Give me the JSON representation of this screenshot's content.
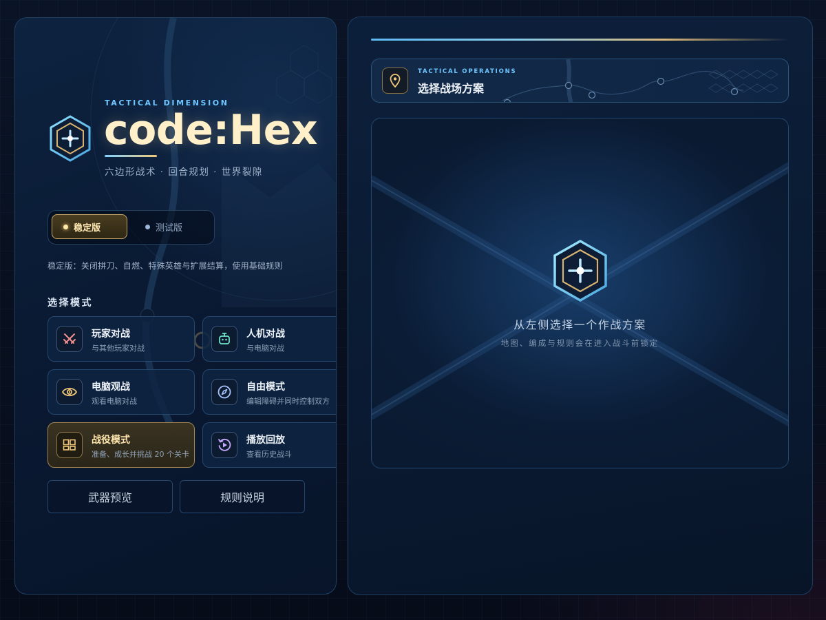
{
  "brand": {
    "kicker": "TACTICAL DIMENSION",
    "title": "code:Hex",
    "subtitle": "六边形战术 · 回合规划 · 世界裂隙",
    "logo_icon": "hex-crosshair-icon"
  },
  "version": {
    "options": [
      {
        "label": "稳定版",
        "selected": true
      },
      {
        "label": "测试版",
        "selected": false
      }
    ],
    "description": "稳定版：关闭拼刀、自燃、特殊英雄与扩展结算，使用基础规则"
  },
  "modes": {
    "heading": "选择模式",
    "items": [
      {
        "title": "玩家对战",
        "desc": "与其他玩家对战",
        "icon": "crossed-swords-icon"
      },
      {
        "title": "人机对战",
        "desc": "与电脑对战",
        "icon": "robot-icon"
      },
      {
        "title": "电脑观战",
        "desc": "观看电脑对战",
        "icon": "eye-icon"
      },
      {
        "title": "自由模式",
        "desc": "编辑障碍并同时控制双方",
        "icon": "compass-icon"
      },
      {
        "title": "战役模式",
        "desc": "准备、成长并挑战 20 个关卡",
        "icon": "campaign-grid-icon",
        "highlight": true
      },
      {
        "title": "播放回放",
        "desc": "查看历史战斗",
        "icon": "replay-icon"
      }
    ]
  },
  "footer": {
    "weapons_label": "武器预览",
    "rules_label": "规则说明"
  },
  "operations": {
    "kicker": "TACTICAL OPERATIONS",
    "title": "选择战场方案",
    "icon": "map-pin-icon"
  },
  "preview": {
    "title": "从左侧选择一个作战方案",
    "subtitle": "地图、编成与规则会在进入战斗前锁定",
    "icon": "hex-crosshair-icon"
  },
  "colors": {
    "accent_blue": "#6fc6ff",
    "accent_gold": "#f0c878",
    "title_cream": "#fff0c9"
  }
}
